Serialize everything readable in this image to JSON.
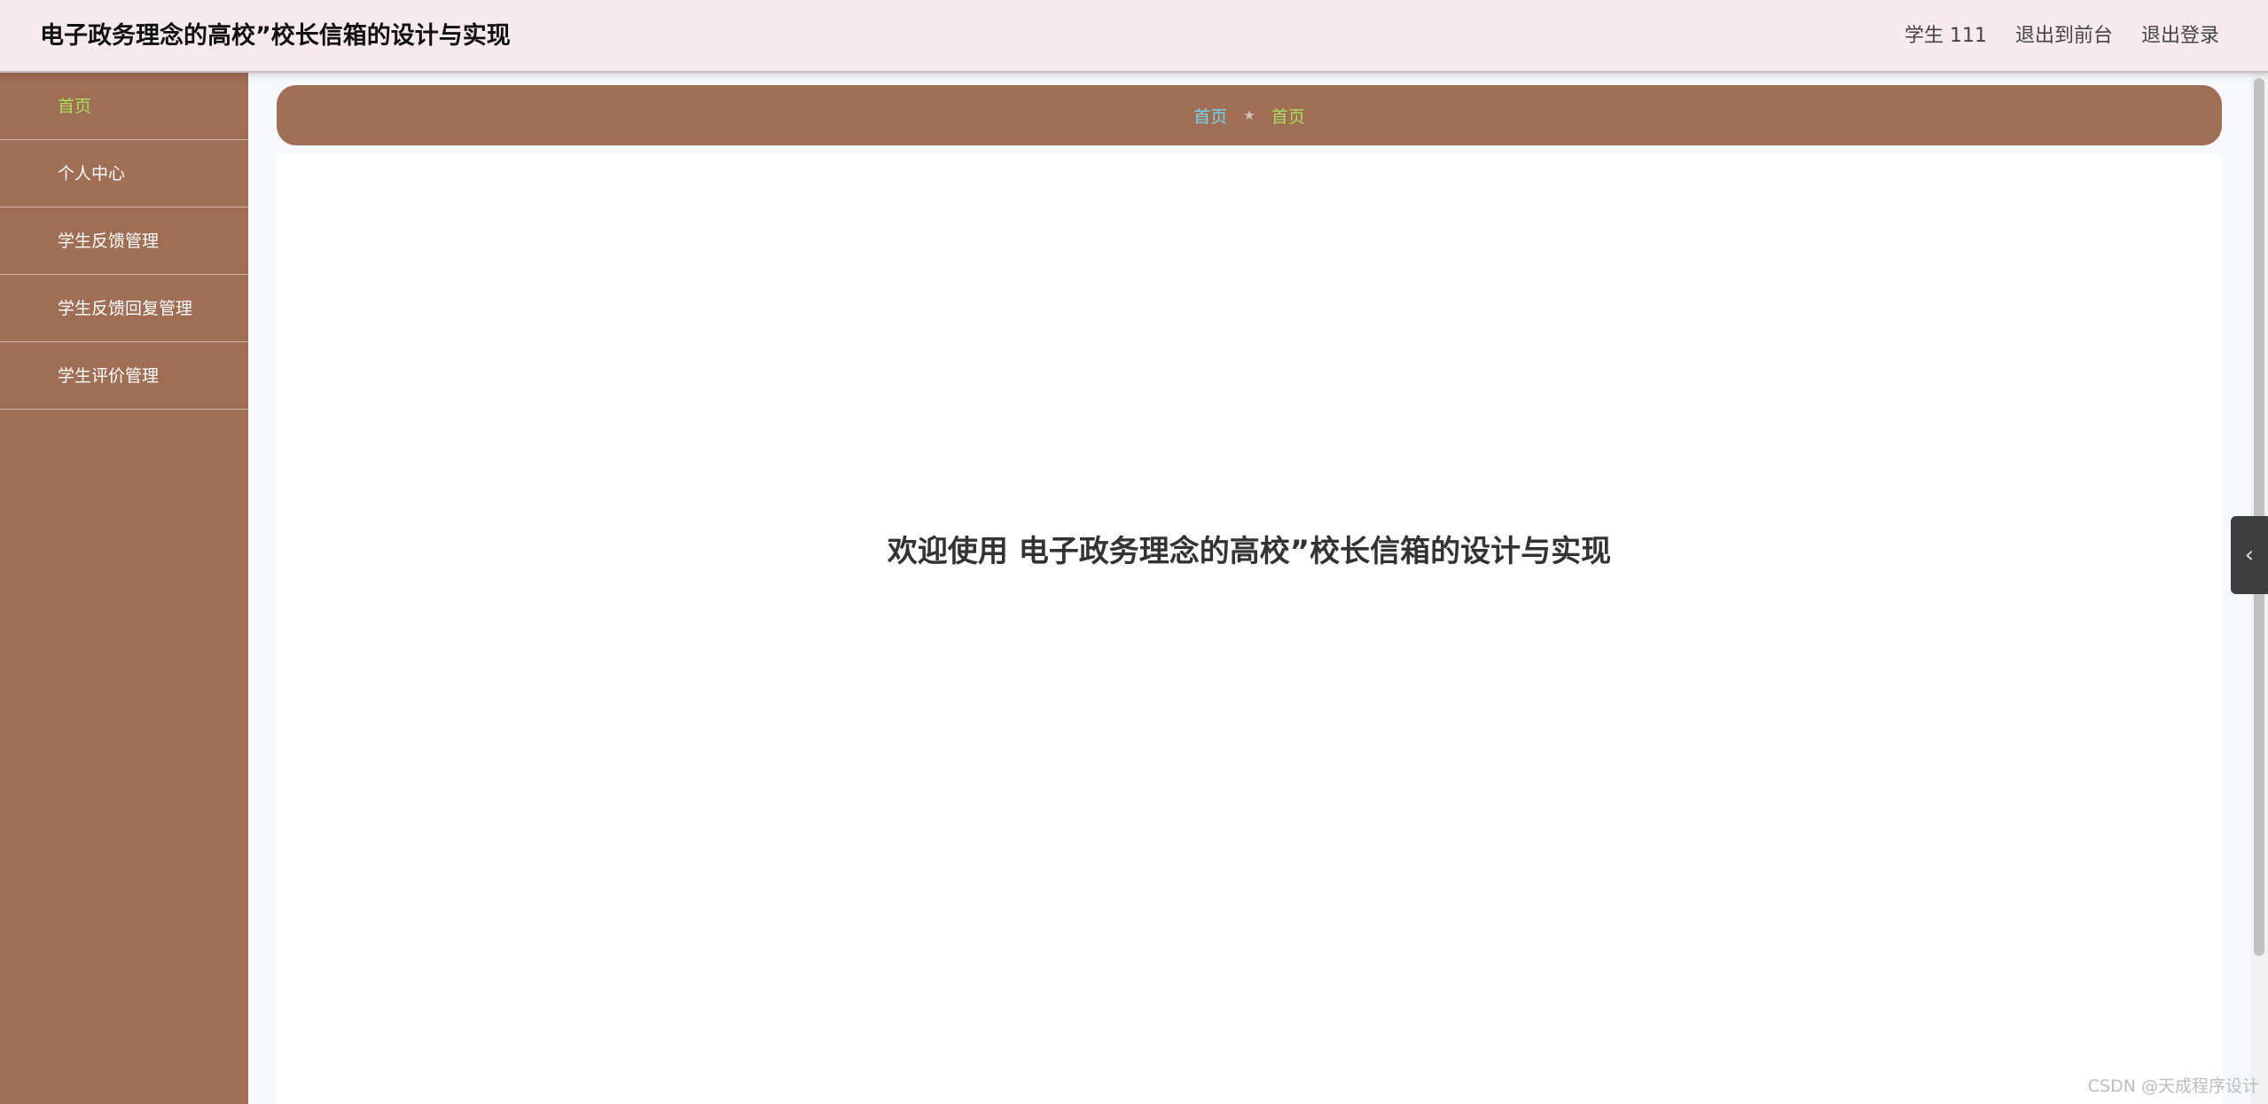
{
  "header": {
    "title": "电子政务理念的高校”校长信箱的设计与实现",
    "user_label": "学生 111",
    "to_front_label": "退出到前台",
    "logout_label": "退出登录"
  },
  "sidebar": {
    "items": [
      {
        "label": "首页"
      },
      {
        "label": "个人中心"
      },
      {
        "label": "学生反馈管理"
      },
      {
        "label": "学生反馈回复管理"
      },
      {
        "label": "学生评价管理"
      }
    ]
  },
  "breadcrumb": {
    "home": "首页",
    "separator": "★",
    "current": "首页"
  },
  "main": {
    "welcome": "欢迎使用 电子政务理念的高校”校长信箱的设计与实现"
  },
  "side_toggle": {
    "glyph": "‹"
  },
  "watermark": {
    "text": "CSDN @天成程序设计"
  },
  "colors": {
    "accent": "#a06d55",
    "active_text": "#a6e05a",
    "link": "#6fd6ee",
    "header_bg": "#f7eaee"
  }
}
